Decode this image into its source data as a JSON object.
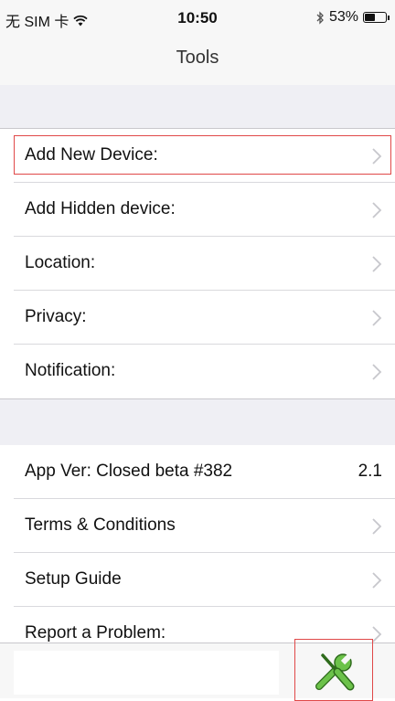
{
  "status_bar": {
    "carrier": "无 SIM 卡",
    "time": "10:50",
    "battery_percent_text": "53%",
    "battery_level": 0.53,
    "icons": [
      "wifi-icon",
      "bluetooth-icon",
      "battery-icon"
    ]
  },
  "nav": {
    "title": "Tools"
  },
  "section1": {
    "rows": [
      {
        "label": "Add New Device:"
      },
      {
        "label": "Add Hidden device:"
      },
      {
        "label": "Location:"
      },
      {
        "label": "Privacy:"
      },
      {
        "label": "Notification:"
      }
    ]
  },
  "section2": {
    "rows": [
      {
        "label": "App Ver: Closed beta #382",
        "value": "2.1"
      },
      {
        "label": "Terms & Conditions"
      },
      {
        "label": "Setup Guide"
      },
      {
        "label": "Report a Problem:"
      }
    ]
  },
  "tab_bar": {
    "tools_icon": "tools-icon",
    "tools_color": "#6cc24a"
  },
  "colors": {
    "highlight": "#e04848",
    "chevron": "#c7c7cc",
    "group_bg": "#efeff4"
  }
}
